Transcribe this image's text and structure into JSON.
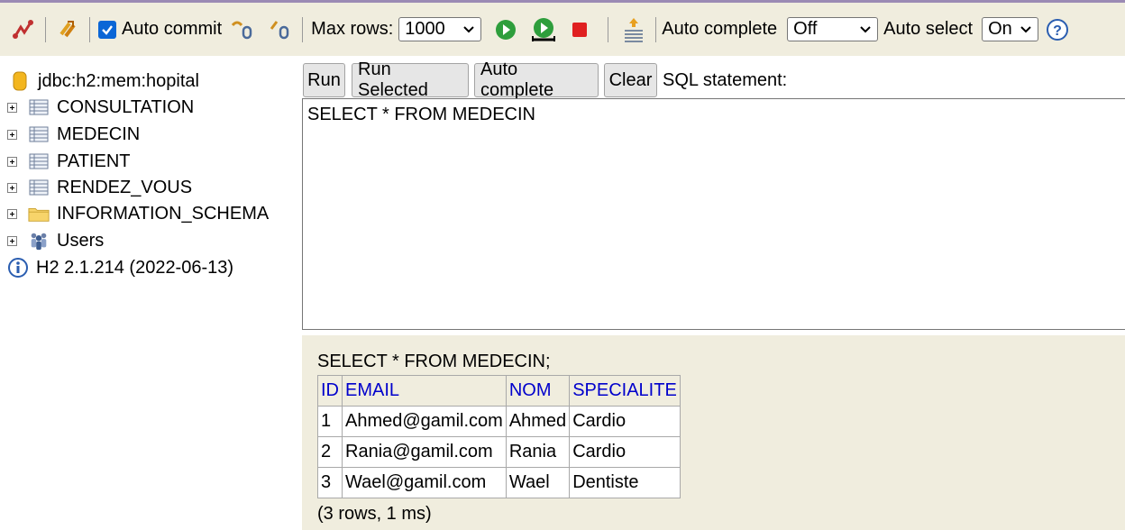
{
  "toolbar": {
    "auto_commit_label": "Auto commit",
    "auto_commit_checked": true,
    "max_rows_label": "Max rows:",
    "max_rows_value": "1000",
    "auto_complete_label": "Auto complete",
    "auto_complete_value": "Off",
    "auto_select_label": "Auto select",
    "auto_select_value": "On"
  },
  "sidebar": {
    "connection": "jdbc:h2:mem:hopital",
    "tables": [
      "CONSULTATION",
      "MEDECIN",
      "PATIENT",
      "RENDEZ_VOUS"
    ],
    "schema": "INFORMATION_SCHEMA",
    "users": "Users",
    "version": "H2 2.1.214 (2022-06-13)"
  },
  "editor": {
    "run_label": "Run",
    "run_selected_label": "Run Selected",
    "auto_complete_label": "Auto complete",
    "clear_label": "Clear",
    "sql_label": "SQL statement:",
    "sql_text": "SELECT * FROM MEDECIN"
  },
  "results": {
    "query": "SELECT * FROM MEDECIN;",
    "columns": [
      "ID",
      "EMAIL",
      "NOM",
      "SPECIALITE"
    ],
    "rows": [
      [
        "1",
        "Ahmed@gamil.com",
        "Ahmed",
        "Cardio"
      ],
      [
        "2",
        "Rania@gamil.com",
        "Rania",
        "Cardio"
      ],
      [
        "3",
        "Wael@gamil.com",
        "Wael",
        "Dentiste"
      ]
    ],
    "footer": "(3 rows, 1 ms)"
  },
  "colors": {
    "toolbar_bg": "#f0edde",
    "header_link": "#0000cc",
    "run_green": "#2e9e3c",
    "stop_red": "#e02020"
  }
}
